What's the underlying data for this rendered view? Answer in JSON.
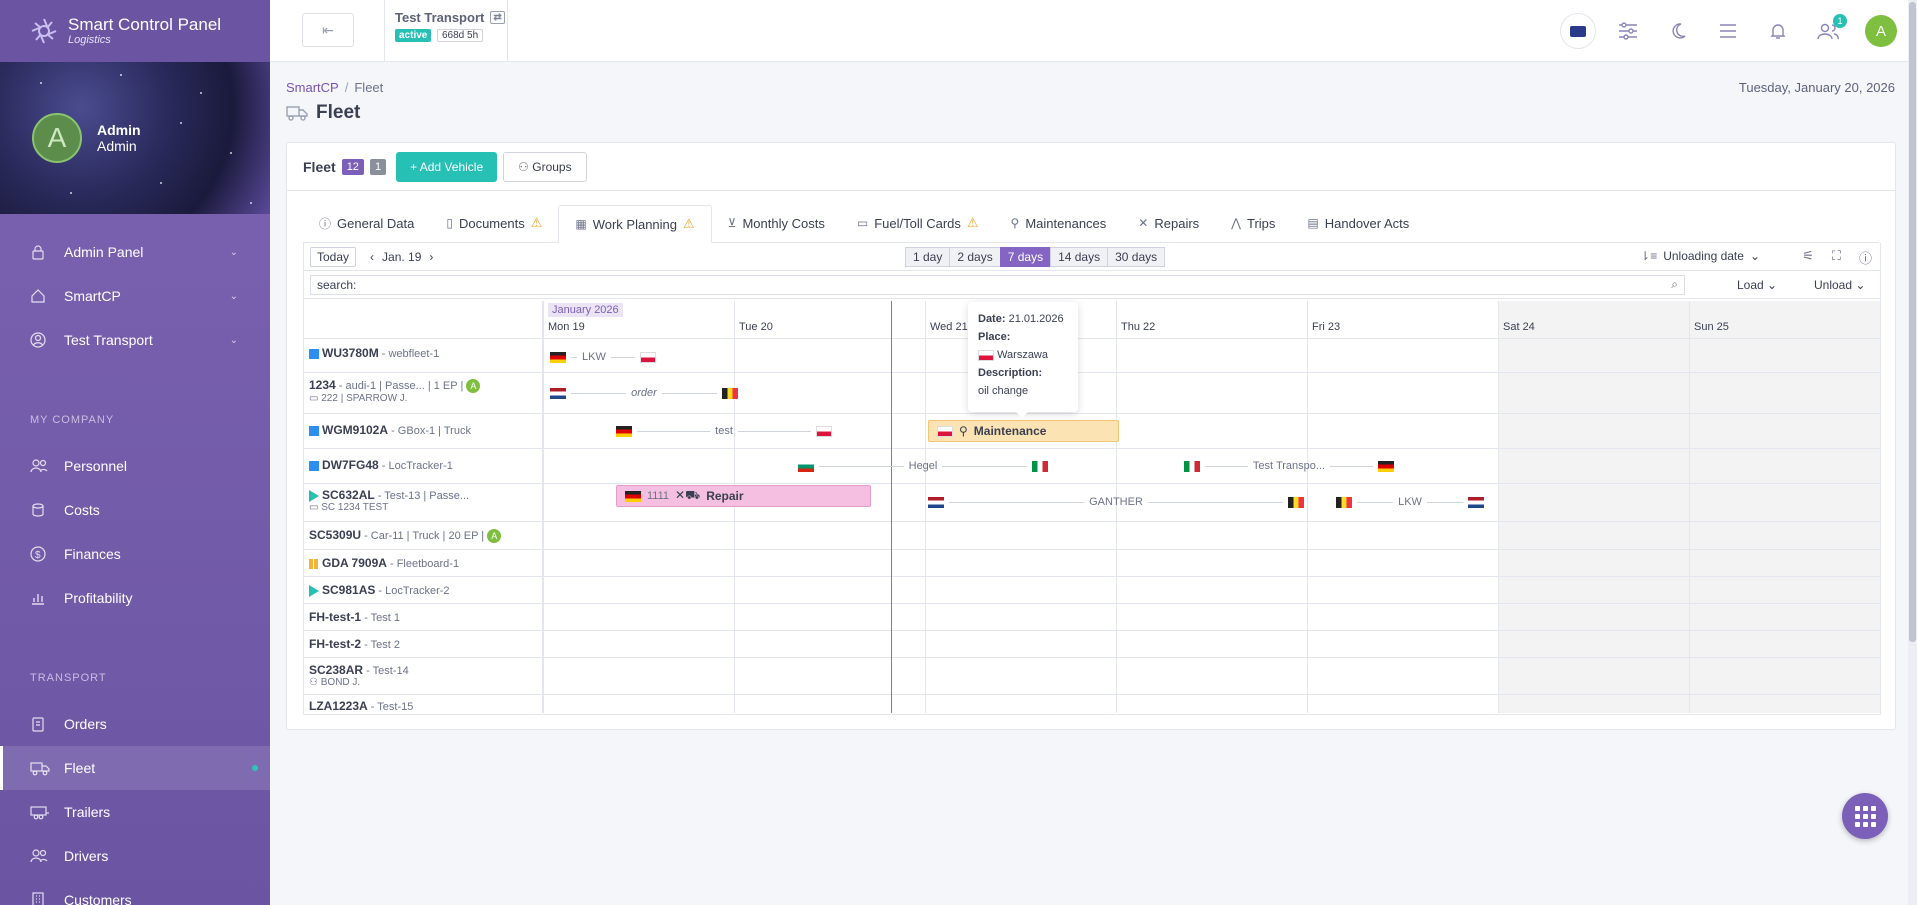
{
  "app": {
    "title": "Smart Control Panel",
    "subtitle": "Logistics"
  },
  "user": {
    "initial": "A",
    "name": "Admin",
    "role": "Admin"
  },
  "sidebar": {
    "main_items": [
      {
        "label": "Admin Panel",
        "icon": "lock-icon"
      },
      {
        "label": "SmartCP",
        "icon": "home-icon"
      },
      {
        "label": "Test Transport",
        "icon": "user-circle-icon"
      }
    ],
    "section_company": "MY COMPANY",
    "company_items": [
      {
        "label": "Personnel",
        "icon": "people-icon"
      },
      {
        "label": "Costs",
        "icon": "coins-icon"
      },
      {
        "label": "Finances",
        "icon": "dollar-icon"
      },
      {
        "label": "Profitability",
        "icon": "chart-icon"
      }
    ],
    "section_transport": "TRANSPORT",
    "transport_items": [
      {
        "label": "Orders",
        "icon": "clipboard-icon"
      },
      {
        "label": "Fleet",
        "icon": "truck-icon",
        "active": true
      },
      {
        "label": "Trailers",
        "icon": "trailer-icon"
      },
      {
        "label": "Drivers",
        "icon": "driver-icon"
      },
      {
        "label": "Customers",
        "icon": "building-icon"
      }
    ]
  },
  "topbar": {
    "company": "Test Transport",
    "status": "active",
    "duration": "668d 5h",
    "notifications_badge": "1",
    "user_initial": "A"
  },
  "breadcrumb": {
    "root": "SmartCP",
    "sep": "/",
    "current": "Fleet"
  },
  "today_label": "Tuesday, January 20, 2026",
  "page_title": "Fleet",
  "fleet_card": {
    "title": "Fleet",
    "count_total": "12",
    "count_other": "1",
    "add_button": "+ Add Vehicle",
    "groups_button": "Groups"
  },
  "tabs": [
    {
      "label": "General Data",
      "icon": "info-icon",
      "warn": false
    },
    {
      "label": "Documents",
      "icon": "document-icon",
      "warn": true
    },
    {
      "label": "Work Planning",
      "icon": "calendar-icon",
      "warn": true,
      "active": true
    },
    {
      "label": "Monthly Costs",
      "icon": "money-icon",
      "warn": false
    },
    {
      "label": "Fuel/Toll Cards",
      "icon": "card-icon",
      "warn": true
    },
    {
      "label": "Maintenances",
      "icon": "wrench-icon",
      "warn": false
    },
    {
      "label": "Repairs",
      "icon": "tools-icon",
      "warn": false
    },
    {
      "label": "Trips",
      "icon": "road-icon",
      "warn": false
    },
    {
      "label": "Handover Acts",
      "icon": "file-icon",
      "warn": false
    }
  ],
  "planner": {
    "today_button": "Today",
    "current_date": "Jan. 19",
    "ranges": [
      "1 day",
      "2 days",
      "7 days",
      "14 days",
      "30 days"
    ],
    "active_range": "7 days",
    "sort_label": "Unloading date",
    "search_label": "search:",
    "load_label": "Load",
    "unload_label": "Unload",
    "month_label": "January 2026",
    "days": [
      "Mon 19",
      "Tue 20",
      "Wed 21",
      "Thu 22",
      "Fri 23",
      "Sat 24",
      "Sun 25"
    ]
  },
  "vehicles": [
    {
      "plate": "WU3780M",
      "info": " - webfleet-1",
      "marker": "blue"
    },
    {
      "plate": "1234",
      "info": " - audi-1 | Passe... | 1 EP |",
      "marker": "none",
      "badge": "A",
      "sub": "222 | SPARROW J."
    },
    {
      "plate": "WGM9102A",
      "info": " - GBox-1 | Truck",
      "marker": "blue"
    },
    {
      "plate": "DW7FG48",
      "info": " - LocTracker-1",
      "marker": "blue"
    },
    {
      "plate": "SC632AL",
      "info": " - Test-13 | Passe...",
      "marker": "play",
      "sub": "SC 1234 TEST"
    },
    {
      "plate": "SC5309U",
      "info": " - Car-11 | Truck | 20 EP |",
      "marker": "none",
      "badge": "A"
    },
    {
      "plate": "GDA 7909A",
      "info": " - Fleetboard-1",
      "marker": "pause"
    },
    {
      "plate": "SC981AS",
      "info": " - LocTracker-2",
      "marker": "play"
    },
    {
      "plate": "FH-test-1",
      "info": " - Test 1",
      "marker": "none"
    },
    {
      "plate": "FH-test-2",
      "info": " - Test 2",
      "marker": "none"
    },
    {
      "plate": "SC238AR",
      "info": " - Test-14",
      "marker": "none",
      "sub": "BOND J."
    },
    {
      "plate": "LZA1223A",
      "info": " - Test-15",
      "marker": "none"
    }
  ],
  "trips": [
    {
      "label": "LKW",
      "from": "de",
      "to": "pl"
    },
    {
      "label": "order",
      "from": "nl",
      "to": "be"
    },
    {
      "label": "test",
      "from": "de",
      "to": "pl"
    },
    {
      "label": "Hegel",
      "from": "bg",
      "to": "it"
    },
    {
      "label": "Test Transpo...",
      "from": "it",
      "to": "de"
    },
    {
      "label": "GANTHER",
      "from": "nl",
      "to": "be"
    },
    {
      "label": "LKW",
      "from": "be",
      "to": "nl"
    }
  ],
  "events": {
    "maintenance": {
      "label": "Maintenance",
      "flag": "pl"
    },
    "repair": {
      "label": "Repair",
      "number": "1111",
      "flag": "de"
    }
  },
  "tooltip": {
    "date_label": "Date:",
    "date_value": "21.01.2026",
    "place_label": "Place:",
    "place_value": "Warszawa",
    "desc_label": "Description:",
    "desc_value": "oil change"
  }
}
